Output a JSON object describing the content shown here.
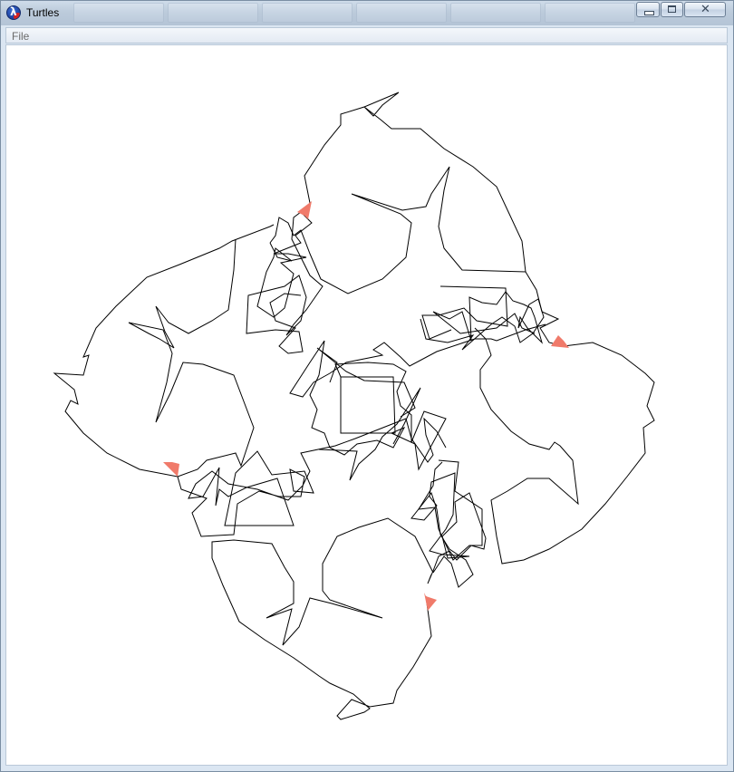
{
  "window": {
    "title": "Turtles",
    "minimize_label": "",
    "maximize_label": "",
    "close_label": "✕"
  },
  "menu": {
    "file_label": "File"
  },
  "colors": {
    "turtle": "#f07a6a",
    "pen": "#000000",
    "titlebar": "#bccbdb"
  },
  "icons": [
    "app-icon",
    "minimize-icon",
    "maximize-icon",
    "close-icon",
    "turtle-icon"
  ]
}
